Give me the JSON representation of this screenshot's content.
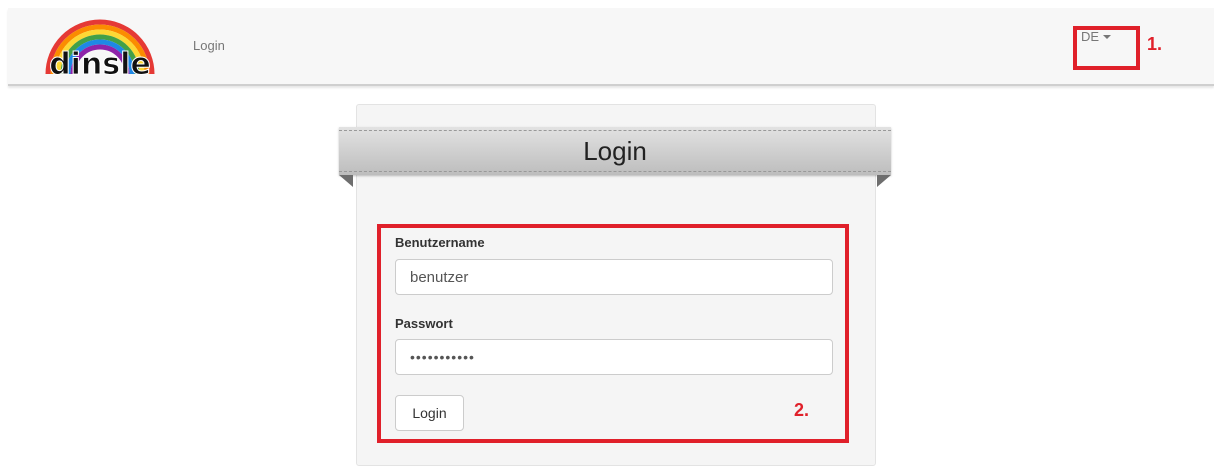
{
  "navbar": {
    "logo_text": "dinsle",
    "nav_link": "Login",
    "language": "DE"
  },
  "annotations": {
    "first": "1.",
    "second": "2."
  },
  "login": {
    "title": "Login",
    "username_label": "Benutzername",
    "username_value": "benutzer",
    "password_label": "Passwort",
    "password_value": "•••••••••••",
    "submit_label": "Login"
  },
  "colors": {
    "annotation_red": "#e0202a",
    "navbar_bg": "#f7f7f7",
    "panel_bg": "#f5f5f5",
    "ribbon": "#c8c8c8"
  }
}
